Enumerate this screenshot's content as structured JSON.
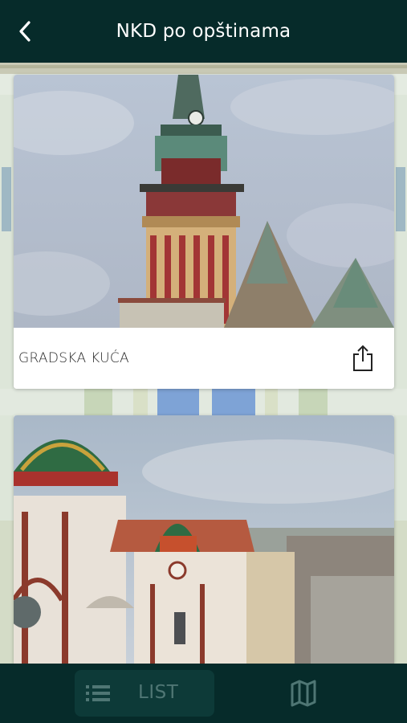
{
  "header": {
    "title": "NKD po opštinama",
    "back_icon": "chevron-left-icon"
  },
  "cards": [
    {
      "title": "GRADSKA KUĆA",
      "image_subject": "town-hall-tower",
      "share_icon": "share-icon"
    },
    {
      "title": "",
      "image_subject": "synagogue-domes"
    }
  ],
  "tabbar": {
    "list_label": "LIST",
    "list_icon": "list-icon",
    "map_icon": "map-icon"
  },
  "colors": {
    "header_bg": "#062b2a",
    "tab_active_bg": "#0d3a38",
    "tab_label": "#4f7674",
    "sky": "#aebbcc"
  }
}
